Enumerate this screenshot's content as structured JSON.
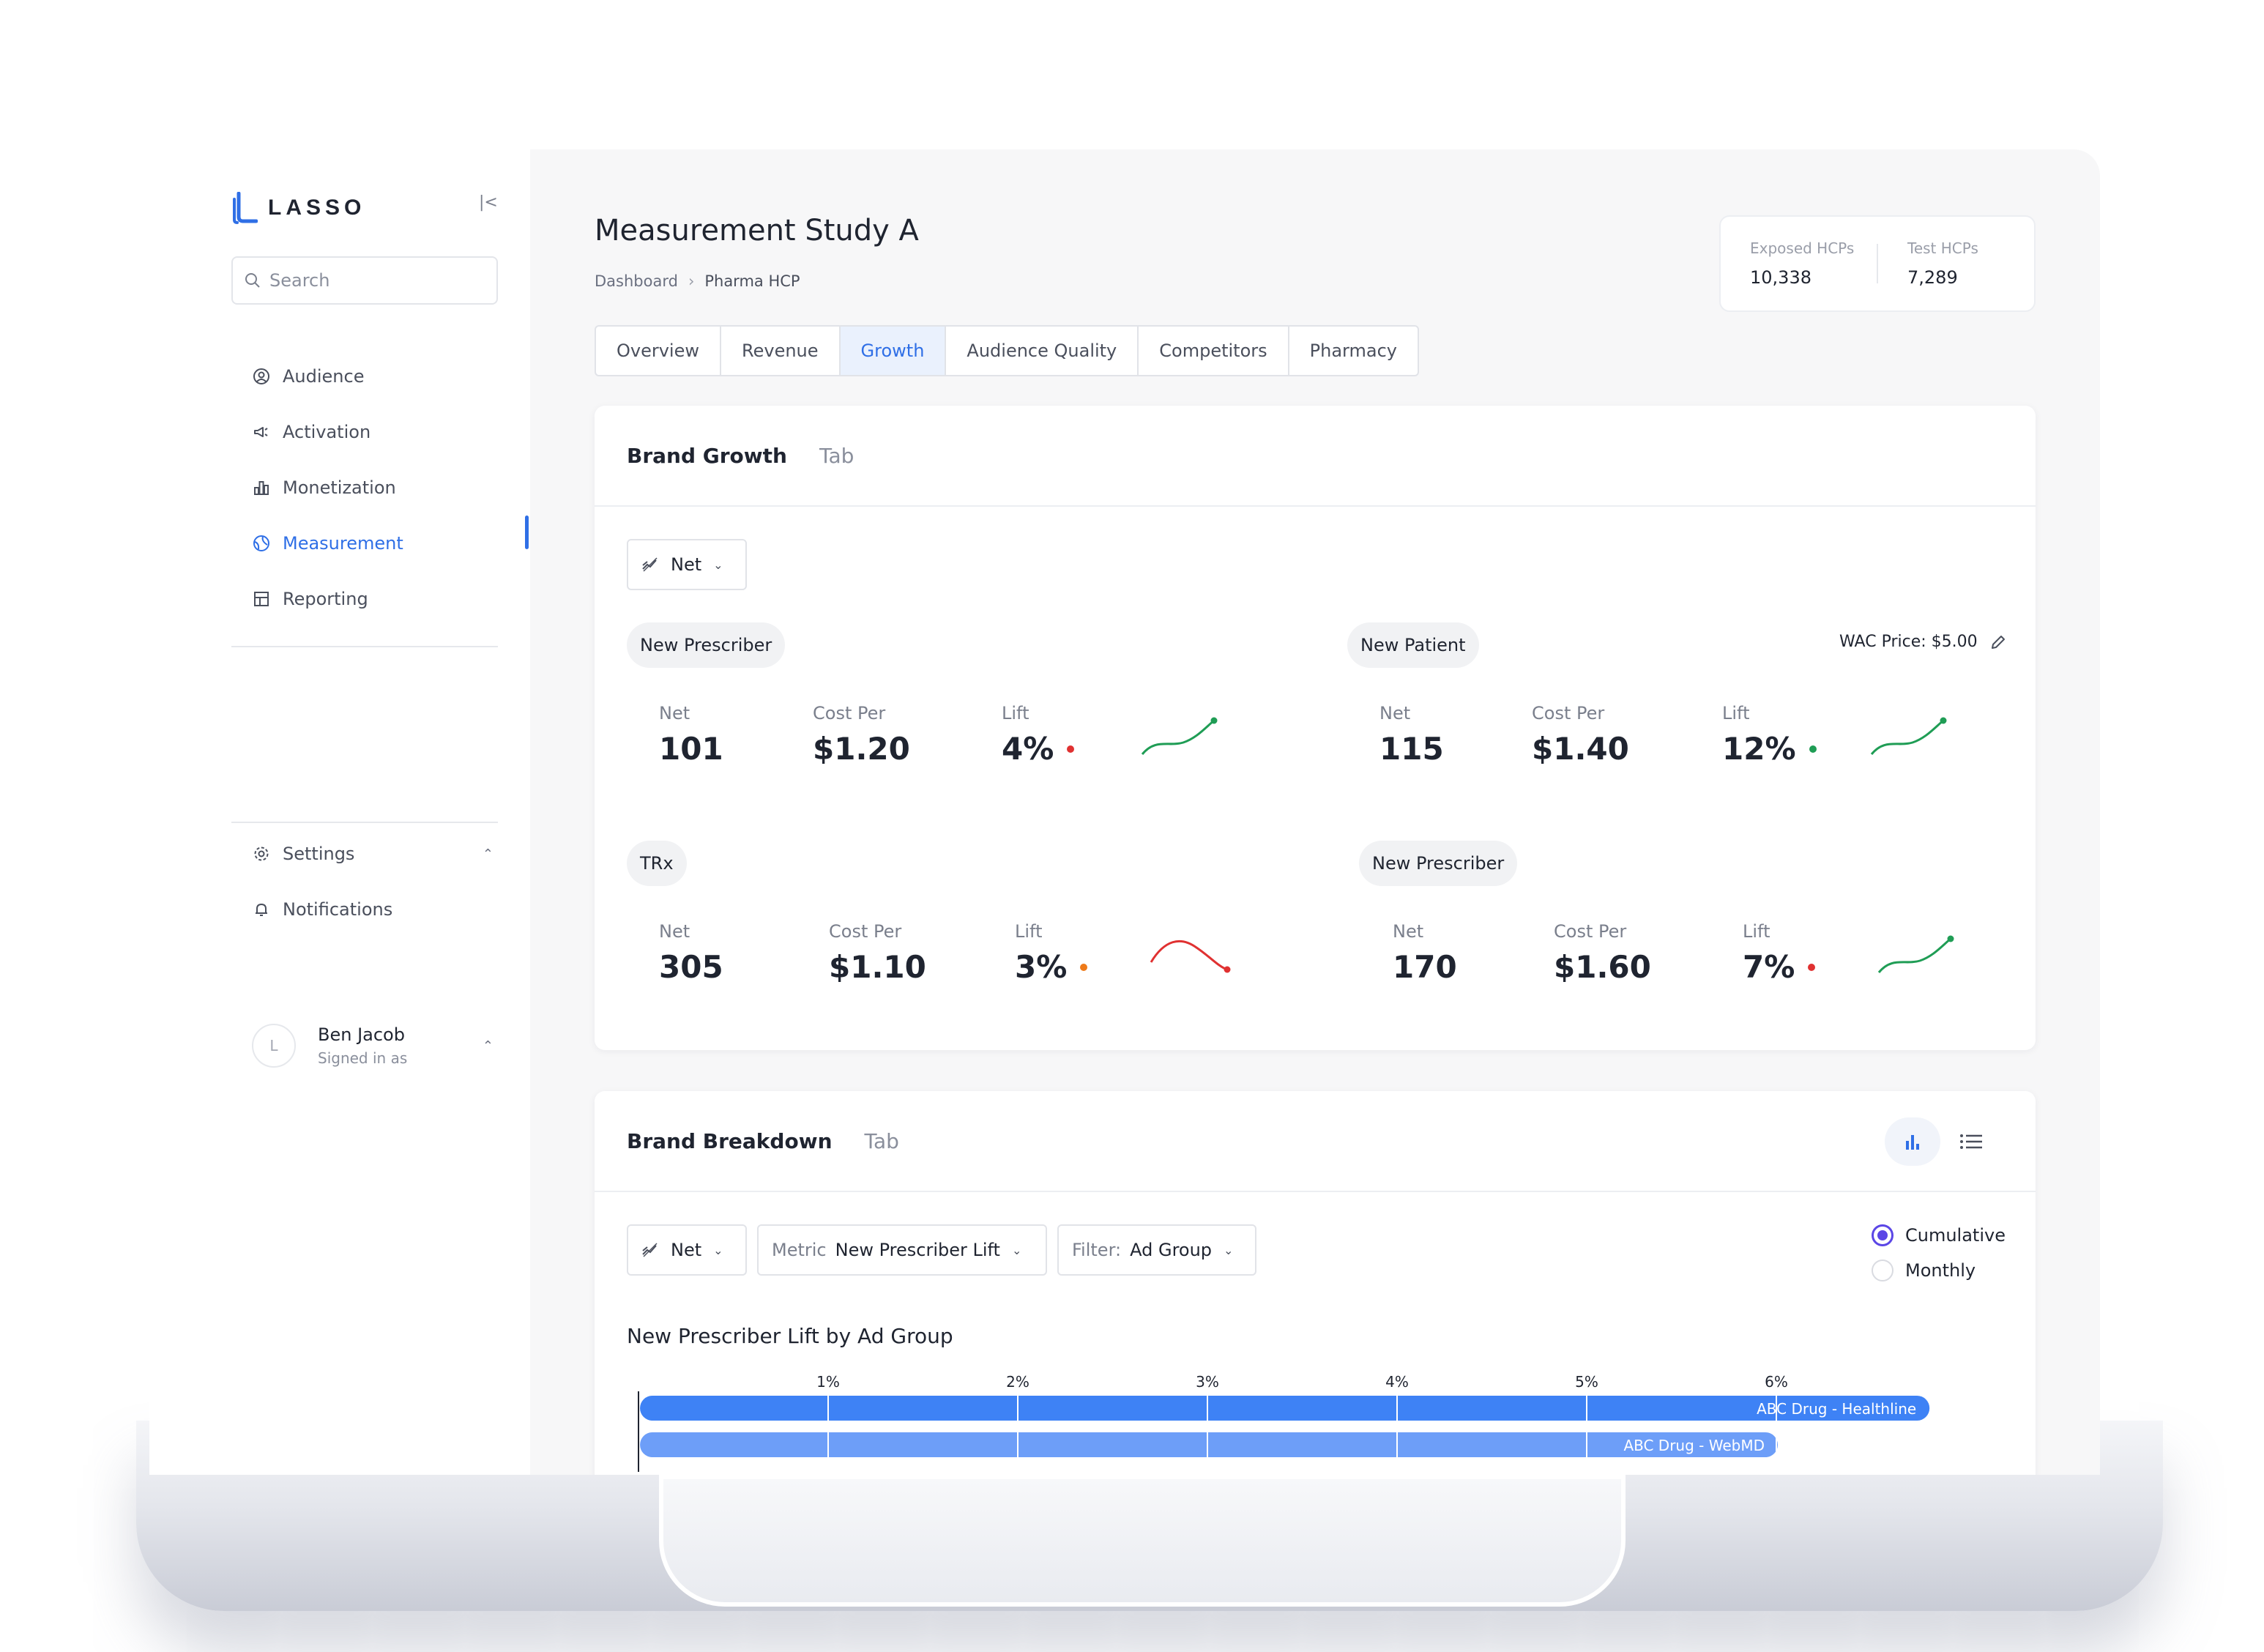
{
  "brand": {
    "name": "LASSO",
    "color": "#2f6fe6"
  },
  "sidebar": {
    "search_placeholder": "Search",
    "items": [
      {
        "label": "Audience",
        "icon": "user-circle-icon"
      },
      {
        "label": "Activation",
        "icon": "megaphone-icon"
      },
      {
        "label": "Monetization",
        "icon": "bar-chart-icon"
      },
      {
        "label": "Measurement",
        "icon": "globe-icon",
        "active": true
      },
      {
        "label": "Reporting",
        "icon": "grid-icon"
      }
    ],
    "settings_label": "Settings",
    "notifications_label": "Notifications",
    "user": {
      "initial": "L",
      "name": "Ben Jacob",
      "sub": "Signed in as"
    }
  },
  "header": {
    "title": "Measurement Study A",
    "breadcrumb": [
      "Dashboard",
      "Pharma HCP"
    ],
    "stats": [
      {
        "label": "Exposed HCPs",
        "value": "10,338"
      },
      {
        "label": "Test HCPs",
        "value": "7,289"
      }
    ],
    "tabs": [
      "Overview",
      "Revenue",
      "Growth",
      "Audience Quality",
      "Competitors",
      "Pharmacy"
    ],
    "active_tab": "Growth"
  },
  "growth": {
    "title": "Brand Growth",
    "tab": "Tab",
    "select_label": "Net",
    "wac_label": "WAC Price: $5.00",
    "labels": {
      "net": "Net",
      "cost": "Cost Per",
      "lift": "Lift"
    },
    "groups": [
      {
        "pill": "New Prescriber",
        "net": "101",
        "cost": "$1.20",
        "lift": "4%",
        "dot": "#e03131",
        "trend": "up"
      },
      {
        "pill": "New Patient",
        "net": "115",
        "cost": "$1.40",
        "lift": "12%",
        "dot": "#1f9d55",
        "trend": "up"
      },
      {
        "pill": "TRx",
        "net": "305",
        "cost": "$1.10",
        "lift": "3%",
        "dot": "#ee7a19",
        "trend": "down"
      },
      {
        "pill": "New Prescriber",
        "net": "170",
        "cost": "$1.60",
        "lift": "7%",
        "dot": "#e03131",
        "trend": "up"
      }
    ]
  },
  "breakdown": {
    "title": "Brand Breakdown",
    "tab": "Tab",
    "net_label": "Net",
    "metric_prefix": "Metric",
    "metric_value": "New Prescriber Lift",
    "filter_prefix": "Filter:",
    "filter_value": "Ad Group",
    "radio": [
      "Cumulative",
      "Monthly"
    ],
    "radio_selected": "Cumulative",
    "chart_title": "New Prescriber Lift by Ad Group"
  },
  "chart_data": {
    "type": "bar",
    "orientation": "horizontal",
    "title": "New Prescriber Lift by Ad Group",
    "x_ticks": [
      "1%",
      "2%",
      "3%",
      "4%",
      "5%",
      "6%"
    ],
    "xlim": [
      0,
      6.8
    ],
    "categories": [
      "ABC Drug - Healthline",
      "ABC Drug - WebMD"
    ],
    "values": [
      6.8,
      6.0
    ],
    "colors": [
      "#3e82f5",
      "#6d9ef8"
    ]
  }
}
